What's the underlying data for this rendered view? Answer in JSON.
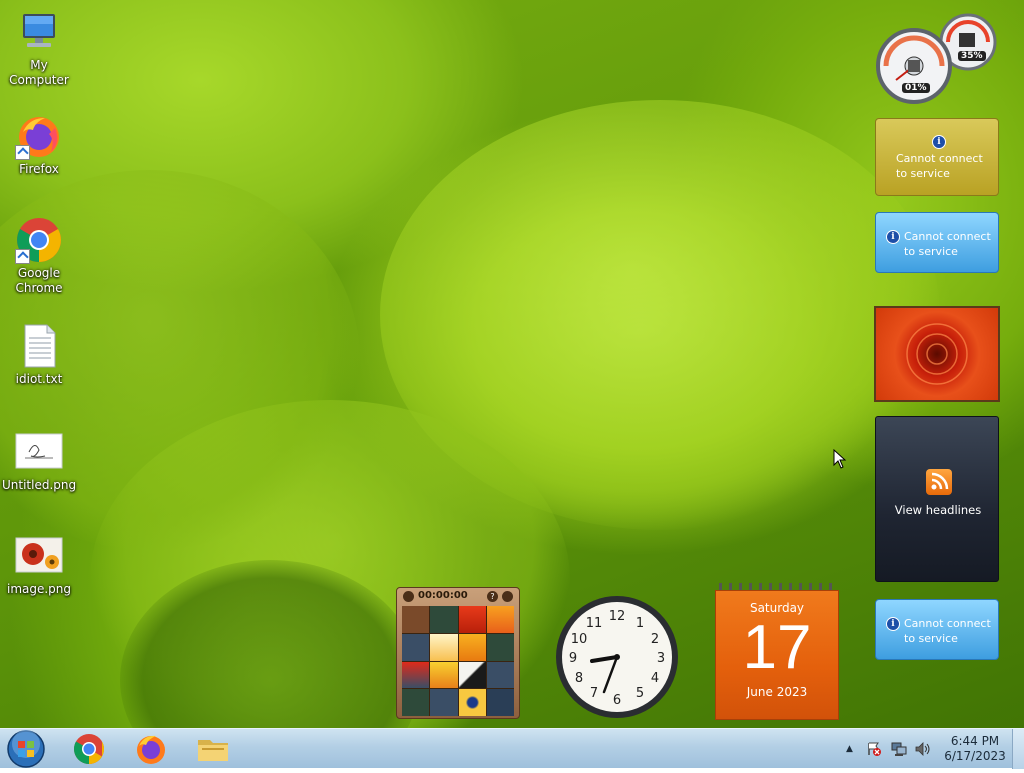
{
  "desktop_icons": [
    {
      "label": "My Computer",
      "icon": "computer-icon"
    },
    {
      "label": "Firefox",
      "icon": "firefox-icon"
    },
    {
      "label": "Google Chrome",
      "icon": "chrome-icon"
    },
    {
      "label": "idiot.txt",
      "icon": "text-file-icon"
    },
    {
      "label": "Untitled.png",
      "icon": "image-file-icon"
    },
    {
      "label": "image.png",
      "icon": "image-file-icon"
    }
  ],
  "gadgets": {
    "cpu_meter": {
      "cpu": "01%",
      "memory": "35%"
    },
    "currency": {
      "message": "Cannot connect to service"
    },
    "weather": {
      "message": "Cannot connect to service"
    },
    "feed": {
      "label": "View headlines"
    },
    "stocks": {
      "message": "Cannot connect to service"
    },
    "puzzle": {
      "timer": "00:00:00"
    },
    "calendar": {
      "weekday": "Saturday",
      "day": "17",
      "month_year": "June 2023"
    }
  },
  "clock": {
    "time": "6:44 PM",
    "date": "6/17/2023"
  },
  "colors": {
    "calendar_orange": "#e8650f",
    "taskbar": "#b3cfe5"
  }
}
